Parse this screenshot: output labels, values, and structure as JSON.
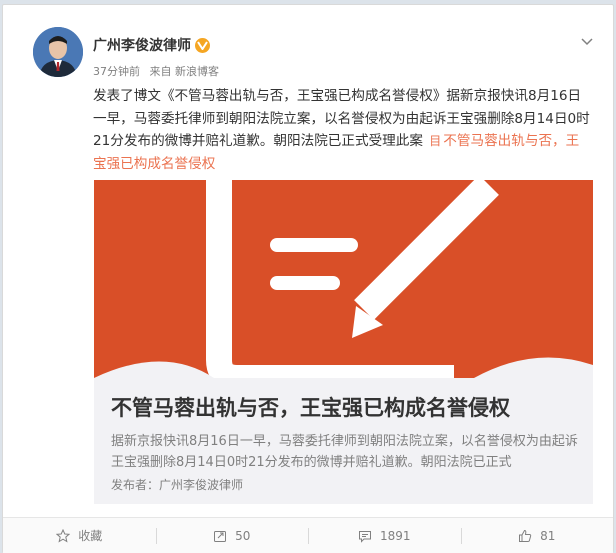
{
  "author": {
    "name": "广州李俊波律师",
    "verified_icon": "v-badge-icon",
    "time": "37分钟前",
    "source": "来自 新浪博客"
  },
  "post": {
    "text_main": "发表了博文《不管马蓉出轨与否，王宝强已构成名誉侵权》据新京报快讯8月16日一早，马蓉委托律师到朝阳法院立案，以名誉侵权为由起诉王宝强删除8月14日0时21分发布的微博并赔礼道歉。朝阳法院已正式受理此案",
    "link_icon": "目",
    "link_text": "不管马蓉出轨与否，王宝强已构成名誉侵权"
  },
  "preview": {
    "title": "不管马蓉出轨与否，王宝强已构成名誉侵权",
    "description": "据新京报快讯8月16日一早，马蓉委托律师到朝阳法院立案，以名誉侵权为由起诉王宝强删除8月14日0时21分发布的微博并赔礼道歉。朝阳法院已正式",
    "author_label": "发布者：广州李俊波律师",
    "image_color": "#d94f28"
  },
  "actions": {
    "favorite": "收藏",
    "repost": "50",
    "comment": "1891",
    "like": "81"
  },
  "colors": {
    "accent": "#eb7350",
    "badge": "#f5a623"
  }
}
